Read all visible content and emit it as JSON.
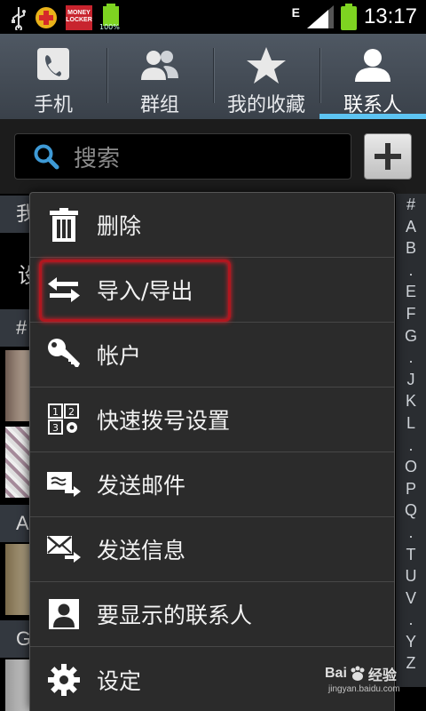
{
  "status_bar": {
    "money_locker_label": "MONEY LOCKER",
    "battery_small_percent": "100%",
    "network_type": "E",
    "time": "13:17",
    "battery_color": "#7ed321"
  },
  "tabs": [
    {
      "label": "手机",
      "icon": "phone-icon",
      "active": false
    },
    {
      "label": "群组",
      "icon": "group-icon",
      "active": false
    },
    {
      "label": "我的收藏",
      "icon": "star-icon",
      "active": false
    },
    {
      "label": "联系人",
      "icon": "contact-icon",
      "active": true
    }
  ],
  "search": {
    "placeholder": "搜索"
  },
  "add_button": {
    "icon": "plus-icon"
  },
  "background_list": {
    "headers": [
      "我",
      "#",
      "A",
      "G"
    ],
    "row_text": "设"
  },
  "index_bar": [
    "#",
    "A",
    "B",
    ".",
    "E",
    "F",
    "G",
    ".",
    "J",
    "K",
    "L",
    ".",
    "O",
    "P",
    "Q",
    ".",
    "T",
    "U",
    "V",
    ".",
    "Y",
    "Z"
  ],
  "menu": {
    "items": [
      {
        "label": "删除",
        "icon": "trash-icon"
      },
      {
        "label": "导入/导出",
        "icon": "import-export-icon",
        "highlighted": true
      },
      {
        "label": "帐户",
        "icon": "key-icon"
      },
      {
        "label": "快速拨号设置",
        "icon": "speed-dial-icon"
      },
      {
        "label": "发送邮件",
        "icon": "send-email-icon"
      },
      {
        "label": "发送信息",
        "icon": "send-message-icon"
      },
      {
        "label": "要显示的联系人",
        "icon": "contacts-display-icon"
      },
      {
        "label": "设定",
        "icon": "settings-icon"
      }
    ]
  },
  "watermark": {
    "brand": "Bai",
    "brand_cn": "经验",
    "url": "jingyan.baidu.com"
  },
  "colors": {
    "accent": "#5dc4f2",
    "highlight_border": "#b0171f"
  }
}
